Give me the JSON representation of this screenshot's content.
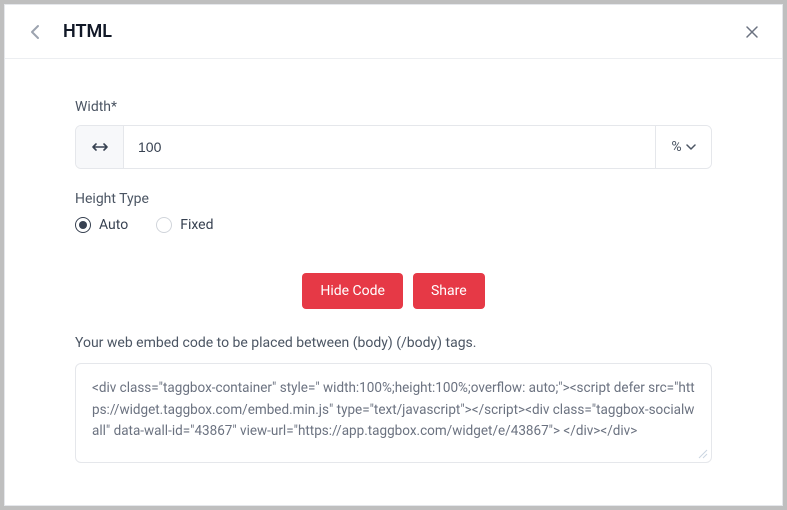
{
  "header": {
    "title": "HTML"
  },
  "width": {
    "label": "Width*",
    "value": "100",
    "unit": "%"
  },
  "heightType": {
    "label": "Height Type",
    "options": {
      "auto": "Auto",
      "fixed": "Fixed"
    },
    "selected": "auto"
  },
  "actions": {
    "hideCode": "Hide Code",
    "share": "Share"
  },
  "embed": {
    "hint": "Your web embed code to be placed between (body) (/body) tags.",
    "code": "<div class=\"taggbox-container\" style=\" width:100%;height:100%;overflow: auto;\"><script defer src=\"https://widget.taggbox.com/embed.min.js\" type=\"text/javascript\"></script><div class=\"taggbox-socialwall\" data-wall-id=\"43867\" view-url=\"https://app.taggbox.com/widget/e/43867\">  </div></div>"
  },
  "colors": {
    "accent": "#e63946"
  }
}
